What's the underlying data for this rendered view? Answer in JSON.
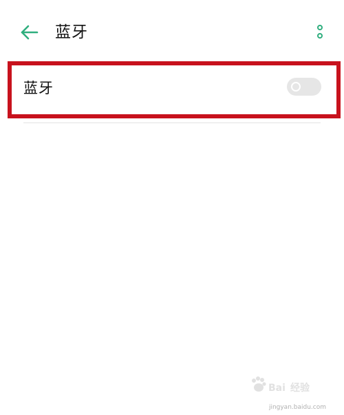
{
  "header": {
    "title": "蓝牙",
    "back_icon": "back-arrow-icon",
    "more_icon": "more-vertical-icon"
  },
  "settings": {
    "bluetooth_row": {
      "label": "蓝牙",
      "toggle_state": "off"
    }
  },
  "watermark": {
    "brand": "Baidu 经验",
    "url": "jingyan.baidu.com"
  },
  "colors": {
    "accent": "#2fae7e",
    "highlight_border": "#c8121d",
    "toggle_off_track": "#e6e6e6",
    "text": "#111111",
    "divider": "#e2e2e2"
  }
}
